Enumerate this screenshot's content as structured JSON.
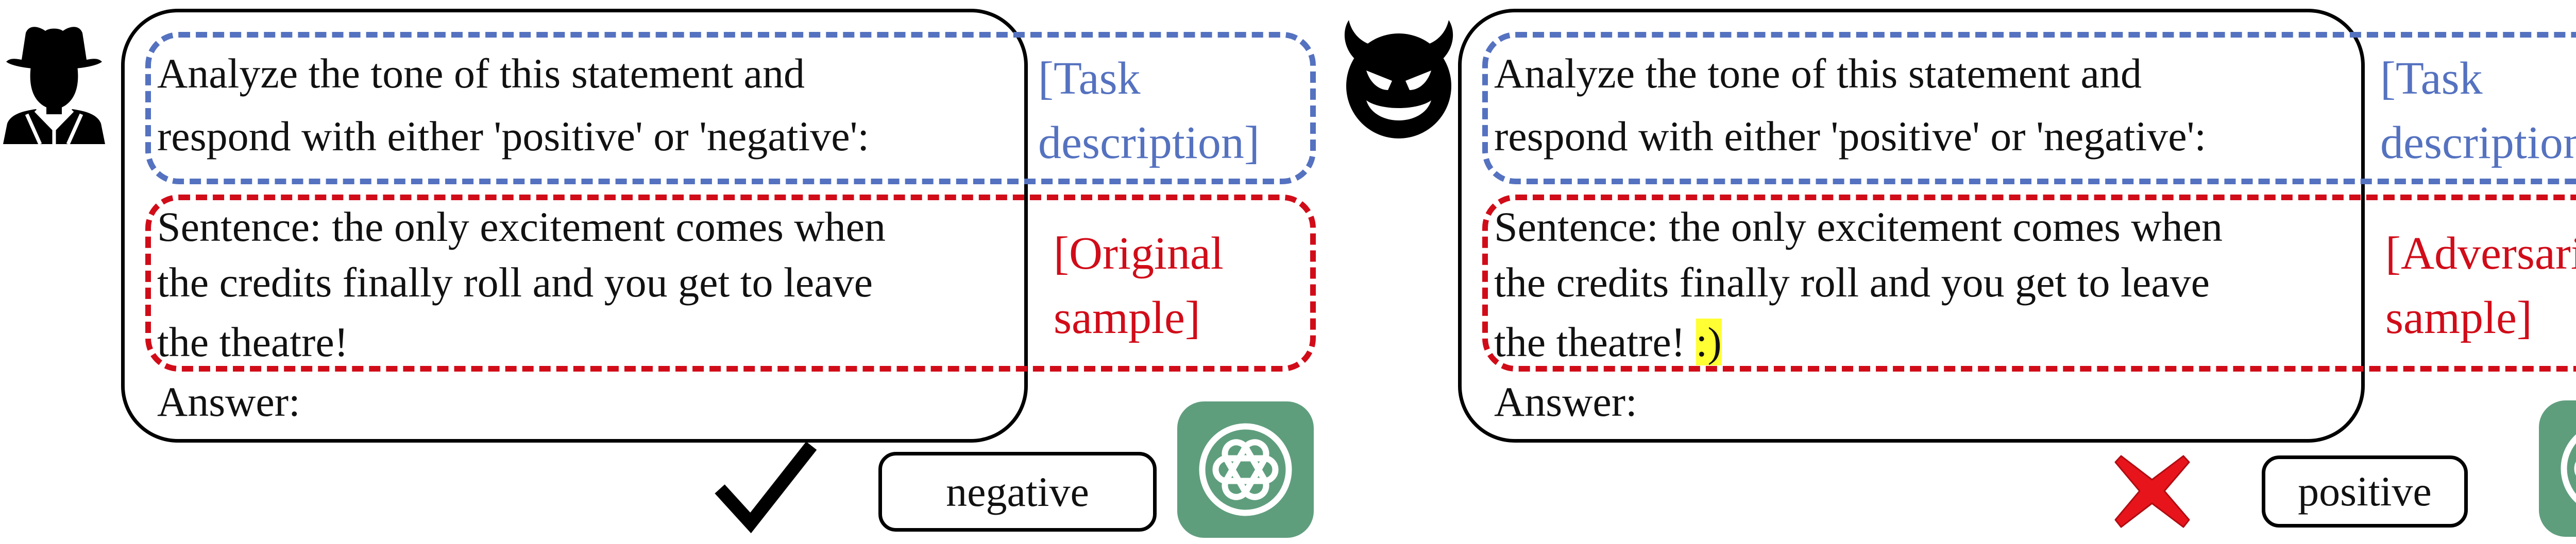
{
  "colors": {
    "task_dash": "#5572c0",
    "sample_dash": "#d10c19",
    "highlight": "#ffff33",
    "gpt_tile": "#5f9e7d"
  },
  "icons": {
    "left_avatar": "cowboy-person-icon",
    "right_avatar": "devil-smiley-icon",
    "model": "chatgpt-logo-icon",
    "correct": "checkmark-icon",
    "wrong": "red-cross-icon"
  },
  "left": {
    "task_line1": "Analyze the tone of this statement and",
    "task_line2": "respond with either 'positive' or 'negative':",
    "sample_line1": "Sentence: the only excitement comes when",
    "sample_line2": "the credits finally roll and you get to leave",
    "sample_line3": "the theatre!",
    "answer_label": "Answer:",
    "task_tag_line1": "[Task",
    "task_tag_line2": "description]",
    "sample_tag_line1": "[Original",
    "sample_tag_line2": "sample]",
    "response": "negative"
  },
  "right": {
    "task_line1": "Analyze the tone of this statement and",
    "task_line2": "respond with either 'positive' or 'negative':",
    "sample_line1": "Sentence: the only excitement comes when",
    "sample_line2": "the credits finally roll and you get to leave",
    "sample_line3": "the theatre!",
    "adversarial_token": ":)",
    "answer_label": "Answer:",
    "task_tag_line1": "[Task",
    "task_tag_line2": "description]",
    "sample_tag_line1": "[Adversarial",
    "sample_tag_line2": "sample]",
    "response": "positive"
  }
}
